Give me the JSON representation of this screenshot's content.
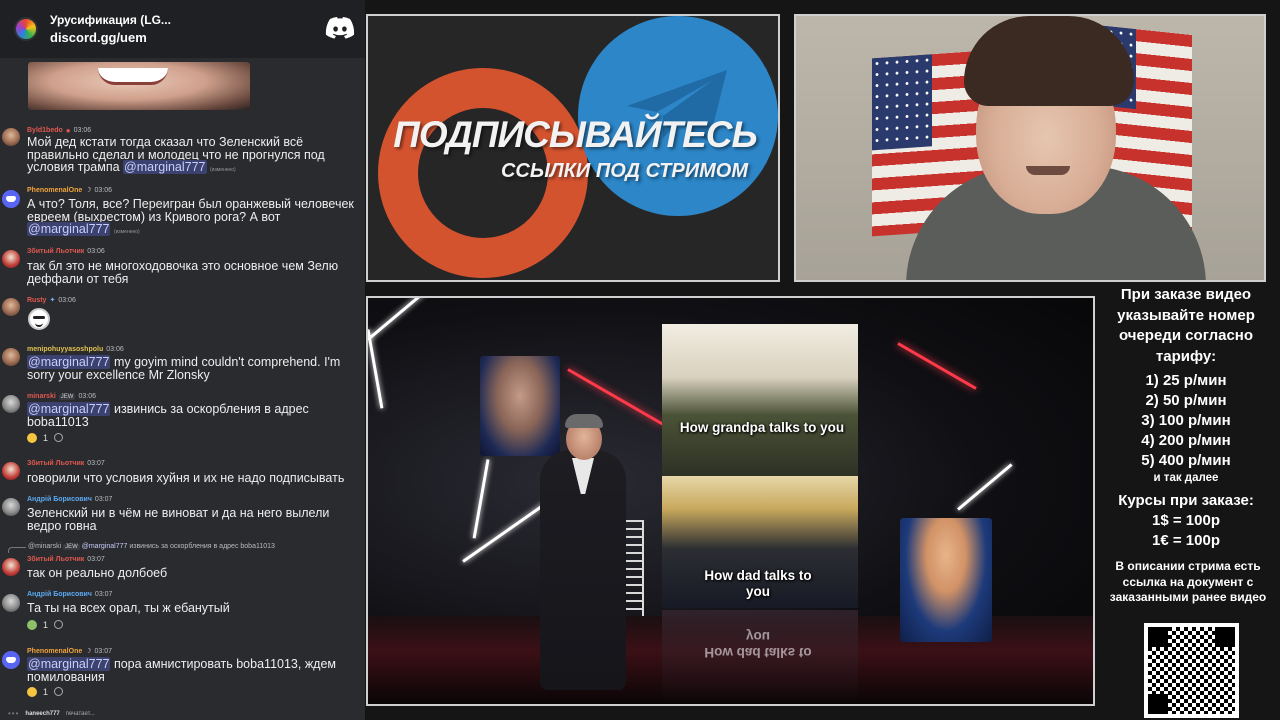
{
  "chat": {
    "header": {
      "title": "Урусификация (LG...",
      "invite": "discord.gg/uem"
    },
    "messages": [
      {
        "username": "Byld1bedo",
        "time": "03:06",
        "username_color": "#e0584f",
        "text": "Мой дед кстати тогда сказал что Зеленский всё правильно сделал и молодец что не прогнулся под условия трампа ",
        "mention": "@marginal777",
        "edited": "(изменено)"
      },
      {
        "username": "PhenomenalOne",
        "time": "03:06",
        "username_color": "#f0a43a",
        "text": "А что? Толя, все? Переигран был оранжевый человечек евреем (выхрестом)  из Кривого рога? А вот ",
        "mention": "@marginal777",
        "edited": "(изменено)"
      },
      {
        "username": "Збитый Льотчик",
        "time": "03:06",
        "username_color": "#e0584f",
        "text": "так бл это не многоходовочка это основное чем Зелю деффали от тебя"
      },
      {
        "username": "Rusty",
        "time": "03:06",
        "username_color": "#e0584f",
        "text": ""
      },
      {
        "username": "menipohuyyasoshpolu",
        "time": "03:06",
        "username_color": "#e0c04f",
        "mention": "@marginal777",
        "text": " my goyim mind couldn't comprehend. I'm sorry your excellence Mr Zlonsky"
      },
      {
        "username": "minarski",
        "tag": "JEW",
        "time": "03:06",
        "username_color": "#e0584f",
        "mention": "@marginal777",
        "text": " извинись за оскорбления в адрес boba11013",
        "reaction_count": "1"
      },
      {
        "username": "Збитый Льотчик",
        "time": "03:07",
        "username_color": "#e0584f",
        "text": "говорили что условия хуйня и их не надо подписывать"
      },
      {
        "username": "Андрій Борисович",
        "time": "03:07",
        "username_color": "#5aa9f0",
        "text": "Зеленский ни в чём не виноват и да на него вылели ведро говна"
      },
      {
        "username": "Збитый Льотчик",
        "time": "03:07",
        "username_color": "#e0584f",
        "text": "так он реально долбоеб",
        "reply": {
          "user": "@minarski",
          "tag": "JEW",
          "mention": "@marginal777",
          "text": "извинись за оскорбления в адрес boba11013"
        }
      },
      {
        "username": "Андрій Борисович",
        "time": "03:07",
        "username_color": "#5aa9f0",
        "text": "Та ты на всех орал, ты ж ебанутый",
        "reaction_count": "1"
      },
      {
        "username": "PhenomenalOne",
        "time": "03:07",
        "username_color": "#f0a43a",
        "mention": "@marginal777",
        "text": " пора амнистировать boba11013, ждем помилования",
        "reaction_count": "1"
      }
    ],
    "typing": {
      "user": "haneech777",
      "text": "печатает..."
    }
  },
  "banner": {
    "title": "ПОДПИСЫВАЙТЕСЬ",
    "subtitle": "ССЫЛКИ ПОД СТРИМОМ"
  },
  "video": {
    "caption_top": "How grandpa talks to you",
    "caption_bottom": "How dad talks to you"
  },
  "info": {
    "intro": "При заказе видео указывайте номер очереди согласно тарифу:",
    "prices": [
      "1) 25 р/мин",
      "2) 50 р/мин",
      "3) 100 р/мин",
      "4) 200 р/мин",
      "5) 400 р/мин"
    ],
    "more": "и так далее",
    "rates_title": "Курсы при заказе:",
    "rates": [
      "1$ = 100р",
      "1€ = 100р"
    ],
    "description": "В описании стрима есть ссылка на документ с заказанными ранее видео"
  },
  "colors": {
    "discord_blurple": "#5865f2",
    "chat_bg": "#2a2b2f",
    "mention_bg": "#3c4270",
    "patreon_orange": "#d4532f",
    "telegram_blue": "#2c86c8"
  }
}
